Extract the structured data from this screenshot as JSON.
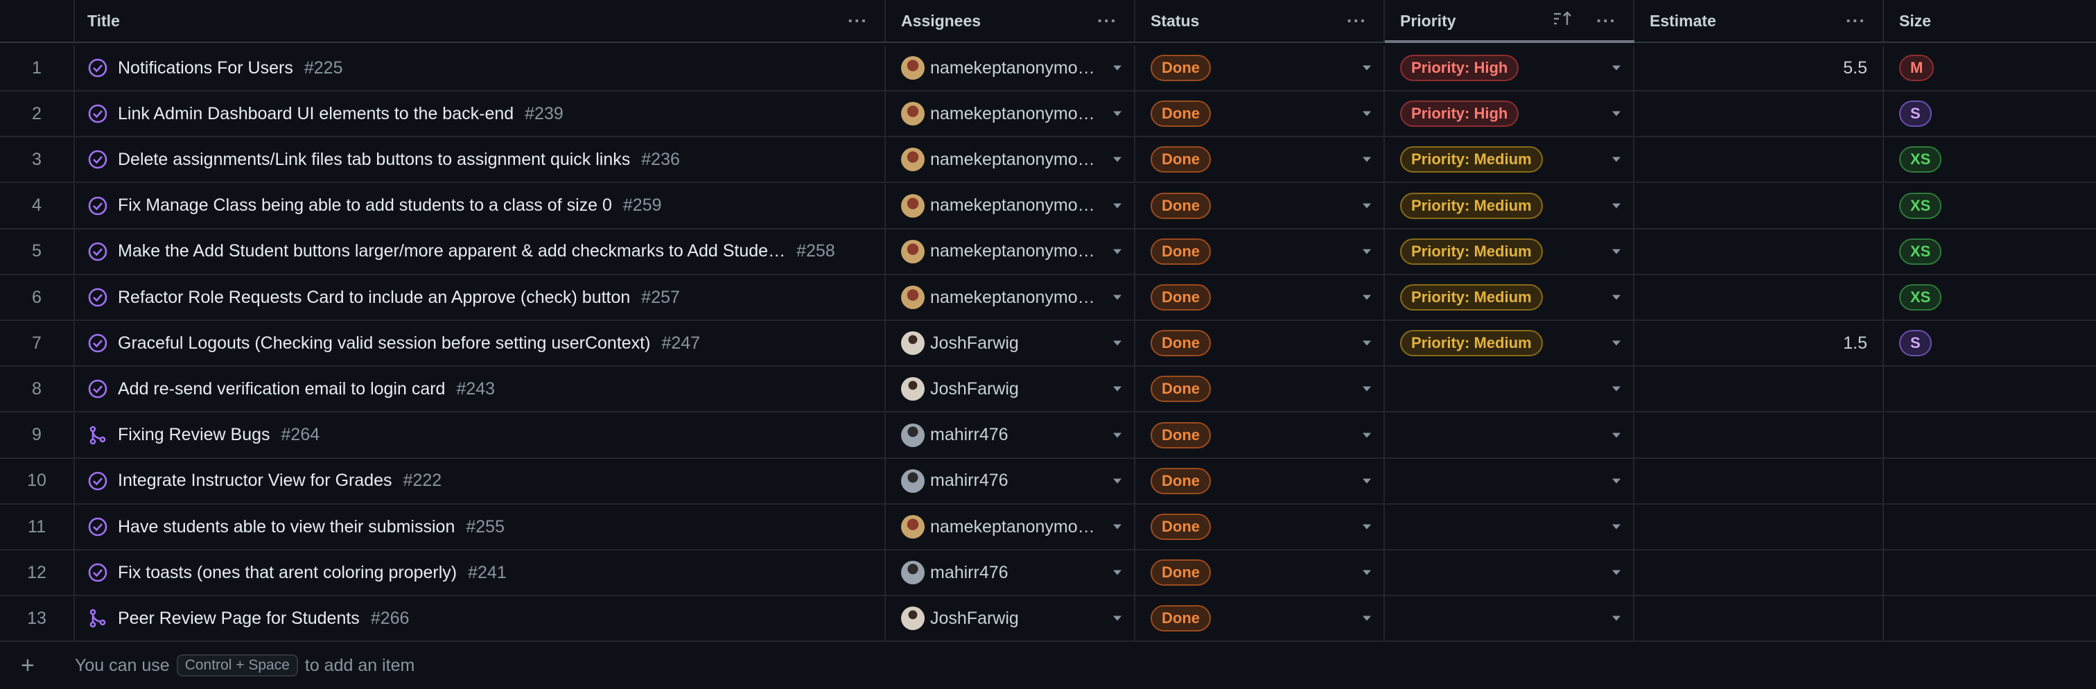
{
  "header": {
    "num": "",
    "title": "Title",
    "assignees": "Assignees",
    "status": "Status",
    "priority": "Priority",
    "estimate": "Estimate",
    "size": "Size",
    "more_icon": "···",
    "sort_icon": "sort-ascending-icon"
  },
  "rows": [
    {
      "num": "1",
      "icon": "issue-closed",
      "title": "Notifications For Users",
      "issue": "#225",
      "assignee": "namekeptanonymo…",
      "avatar": "a",
      "status": "Done",
      "priority": "Priority: High",
      "prio_class": "high",
      "estimate": "5.5",
      "size": "M"
    },
    {
      "num": "2",
      "icon": "issue-closed",
      "title": "Link Admin Dashboard UI elements to the back-end",
      "issue": "#239",
      "assignee": "namekeptanonymo…",
      "avatar": "a",
      "status": "Done",
      "priority": "Priority: High",
      "prio_class": "high",
      "estimate": "",
      "size": "S"
    },
    {
      "num": "3",
      "icon": "issue-closed",
      "title": "Delete assignments/Link files tab buttons to assignment quick links",
      "issue": "#236",
      "assignee": "namekeptanonymo…",
      "avatar": "a",
      "status": "Done",
      "priority": "Priority: Medium",
      "prio_class": "med",
      "estimate": "",
      "size": "XS"
    },
    {
      "num": "4",
      "icon": "issue-closed",
      "title": "Fix Manage Class being able to add students to a class of size 0",
      "issue": "#259",
      "assignee": "namekeptanonymo…",
      "avatar": "a",
      "status": "Done",
      "priority": "Priority: Medium",
      "prio_class": "med",
      "estimate": "",
      "size": "XS"
    },
    {
      "num": "5",
      "icon": "issue-closed",
      "title": "Make the Add Student buttons larger/more apparent & add checkmarks to Add Stude…",
      "issue": "#258",
      "assignee": "namekeptanonymo…",
      "avatar": "a",
      "status": "Done",
      "priority": "Priority: Medium",
      "prio_class": "med",
      "estimate": "",
      "size": "XS"
    },
    {
      "num": "6",
      "icon": "issue-closed",
      "title": "Refactor Role Requests Card to include an Approve (check) button",
      "issue": "#257",
      "assignee": "namekeptanonymo…",
      "avatar": "a",
      "status": "Done",
      "priority": "Priority: Medium",
      "prio_class": "med",
      "estimate": "",
      "size": "XS"
    },
    {
      "num": "7",
      "icon": "issue-closed",
      "title": "Graceful Logouts (Checking valid session before setting userContext)",
      "issue": "#247",
      "assignee": "JoshFarwig",
      "avatar": "b",
      "status": "Done",
      "priority": "Priority: Medium",
      "prio_class": "med",
      "estimate": "1.5",
      "size": "S"
    },
    {
      "num": "8",
      "icon": "issue-closed",
      "title": "Add re-send verification email to login card",
      "issue": "#243",
      "assignee": "JoshFarwig",
      "avatar": "b",
      "status": "Done",
      "priority": "",
      "prio_class": "",
      "estimate": "",
      "size": ""
    },
    {
      "num": "9",
      "icon": "pr-merged",
      "title": "Fixing Review Bugs",
      "issue": "#264",
      "assignee": "mahirr476",
      "avatar": "c",
      "status": "Done",
      "priority": "",
      "prio_class": "",
      "estimate": "",
      "size": ""
    },
    {
      "num": "10",
      "icon": "issue-closed",
      "title": "Integrate Instructor View for Grades",
      "issue": "#222",
      "assignee": "mahirr476",
      "avatar": "c",
      "status": "Done",
      "priority": "",
      "prio_class": "",
      "estimate": "",
      "size": ""
    },
    {
      "num": "11",
      "icon": "issue-closed",
      "title": "Have students able to view their submission",
      "issue": "#255",
      "assignee": "namekeptanonymo…",
      "avatar": "a",
      "status": "Done",
      "priority": "",
      "prio_class": "",
      "estimate": "",
      "size": ""
    },
    {
      "num": "12",
      "icon": "issue-closed",
      "title": "Fix toasts (ones that arent coloring properly)",
      "issue": "#241",
      "assignee": "mahirr476",
      "avatar": "c",
      "status": "Done",
      "priority": "",
      "prio_class": "",
      "estimate": "",
      "size": ""
    },
    {
      "num": "13",
      "icon": "pr-merged",
      "title": "Peer Review Page for Students",
      "issue": "#266",
      "assignee": "JoshFarwig",
      "avatar": "b",
      "status": "Done",
      "priority": "",
      "prio_class": "",
      "estimate": "",
      "size": ""
    }
  ],
  "footer": {
    "before": "You can use",
    "shortcut": "Control + Space",
    "after": "to add an item"
  },
  "colors": {
    "background": "#0d1117",
    "accent_purple": "#a371f7",
    "done": "#f0883e"
  }
}
